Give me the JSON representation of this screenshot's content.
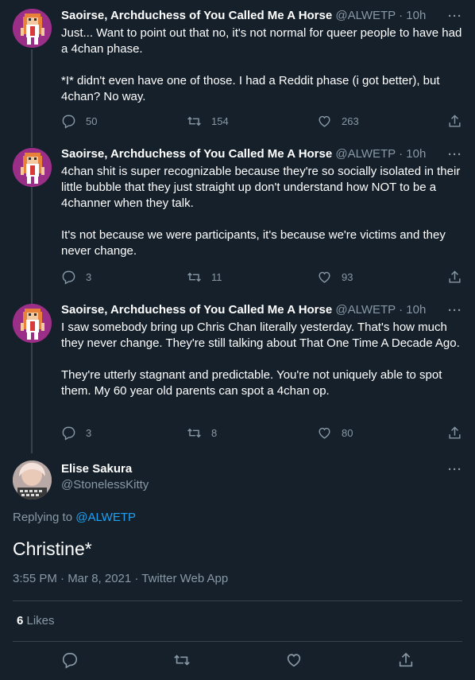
{
  "thread": [
    {
      "name": "Saoirse, Archduchess of You Called Me A Horse",
      "handle": "@ALWETP",
      "dot": "·",
      "time": "10h",
      "text": "Just... Want to point out that no, it's not normal for queer people to have had a 4chan phase.\n\n*I* didn't even have one of those. I had a Reddit phase (i got better), but 4chan? No way.",
      "replies": "50",
      "retweets": "154",
      "likes": "263"
    },
    {
      "name": "Saoirse, Archduchess of You Called Me A Horse",
      "handle": "@ALWETP",
      "dot": "·",
      "time": "10h",
      "text": "4chan shit is super recognizable because they're so socially isolated in their little bubble that they just straight up don't understand how NOT to be a 4channer when they talk.\n\nIt's not because we were participants, it's because we're victims and they never change.",
      "replies": "3",
      "retweets": "11",
      "likes": "93"
    },
    {
      "name": "Saoirse, Archduchess of You Called Me A Horse",
      "handle": "@ALWETP",
      "dot": "·",
      "time": "10h",
      "text": "I saw somebody bring up Chris Chan literally yesterday. That's how much they never change. They're still talking about That One Time A Decade Ago.\n\nThey're utterly stagnant and predictable. You're not uniquely able to spot them. My 60 year old parents can spot a 4chan op.",
      "replies": "3",
      "retweets": "8",
      "likes": "80"
    }
  ],
  "focus": {
    "name": "Elise Sakura",
    "handle": "@StonelessKitty",
    "replying_prefix": "Replying to ",
    "replying_to": "@ALWETP",
    "text": "Christine*",
    "meta": "3:55 PM · Mar 8, 2021 · Twitter Web App",
    "likes_count": "6",
    "likes_label": " Likes"
  },
  "more_label": "···",
  "colors": {
    "background": "#15202b",
    "accent": "#1da1f2",
    "muted": "#8899a6",
    "divider": "#38444d"
  },
  "icons": [
    "reply-icon",
    "retweet-icon",
    "like-icon",
    "share-icon",
    "more-icon"
  ]
}
